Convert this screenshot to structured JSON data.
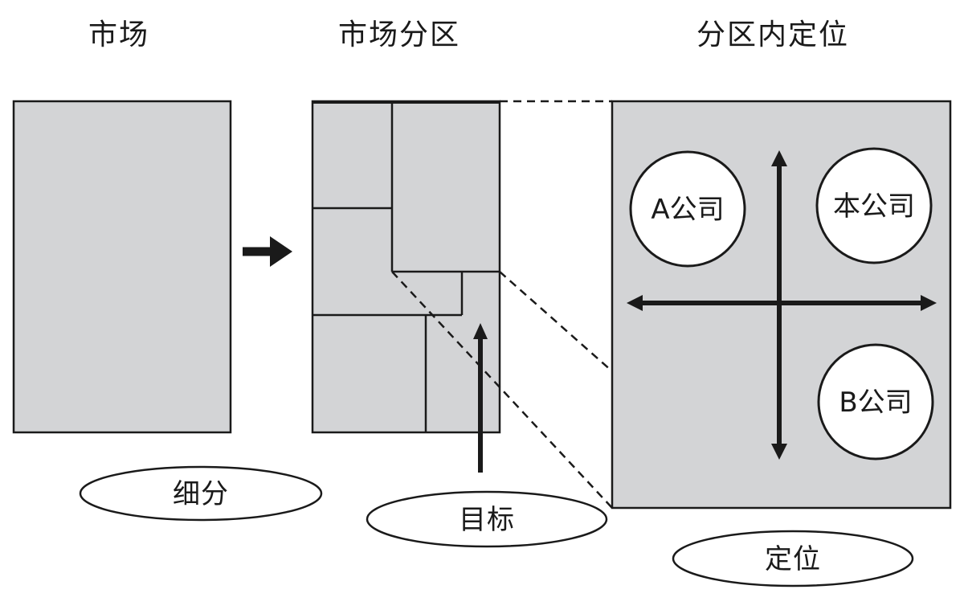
{
  "headings": {
    "market": "市场",
    "segmented": "市场分区",
    "positioning": "分区内定位"
  },
  "steps": {
    "segmentation": "细分",
    "targeting": "目标",
    "positioning": "定位"
  },
  "companies": {
    "a": "A公司",
    "ours": "本公司",
    "b": "B公司"
  },
  "colors": {
    "fill": "#d3d4d6",
    "stroke": "#1a1a1a",
    "background": "#ffffff"
  },
  "icons": [
    "arrow-right-icon",
    "arrow-up-icon",
    "double-arrow-horizontal-icon",
    "double-arrow-vertical-icon"
  ]
}
